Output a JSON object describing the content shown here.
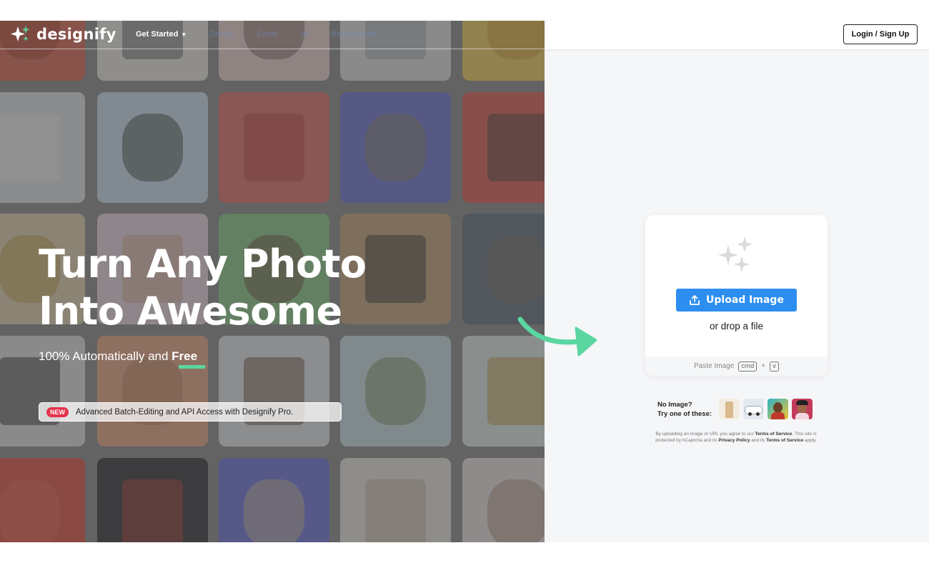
{
  "brand": {
    "name": "designify",
    "accent": "#5ad6a0"
  },
  "nav": {
    "items": [
      {
        "label": "Get Started",
        "has_dropdown": true
      },
      {
        "label": "Design"
      },
      {
        "label": "Cards"
      },
      {
        "label": "AI"
      },
      {
        "label": "Backgrounds"
      }
    ]
  },
  "hero": {
    "headline_line1": "Turn Any Photo",
    "headline_line2": "Into Awesome",
    "subline_prefix": "100% Automatically and ",
    "subline_emphasis": "Free",
    "promo_badge": "NEW",
    "promo_text": "Advanced Batch-Editing and API Access with Designify Pro."
  },
  "header": {
    "login_label": "Login / Sign Up"
  },
  "upload": {
    "button_label": "Upload Image",
    "drop_text": "or drop a file",
    "paste_label": "Paste Image",
    "key_cmd": "cmd",
    "key_plus": "+",
    "key_v": "v",
    "button_color": "#2d8ef0"
  },
  "samples": {
    "label_line1": "No Image?",
    "label_line2": "Try one of these:",
    "thumbs": [
      "sample-bottle",
      "sample-car",
      "sample-man",
      "sample-woman"
    ]
  },
  "legal": {
    "t1": "By uploading an image or URL you agree to our ",
    "terms1": "Terms of Service",
    "t2": ". This site is protected by hCaptcha and its ",
    "privacy": "Privacy Policy",
    "t3": " and its ",
    "terms2": "Terms of Service",
    "t4": " apply."
  }
}
